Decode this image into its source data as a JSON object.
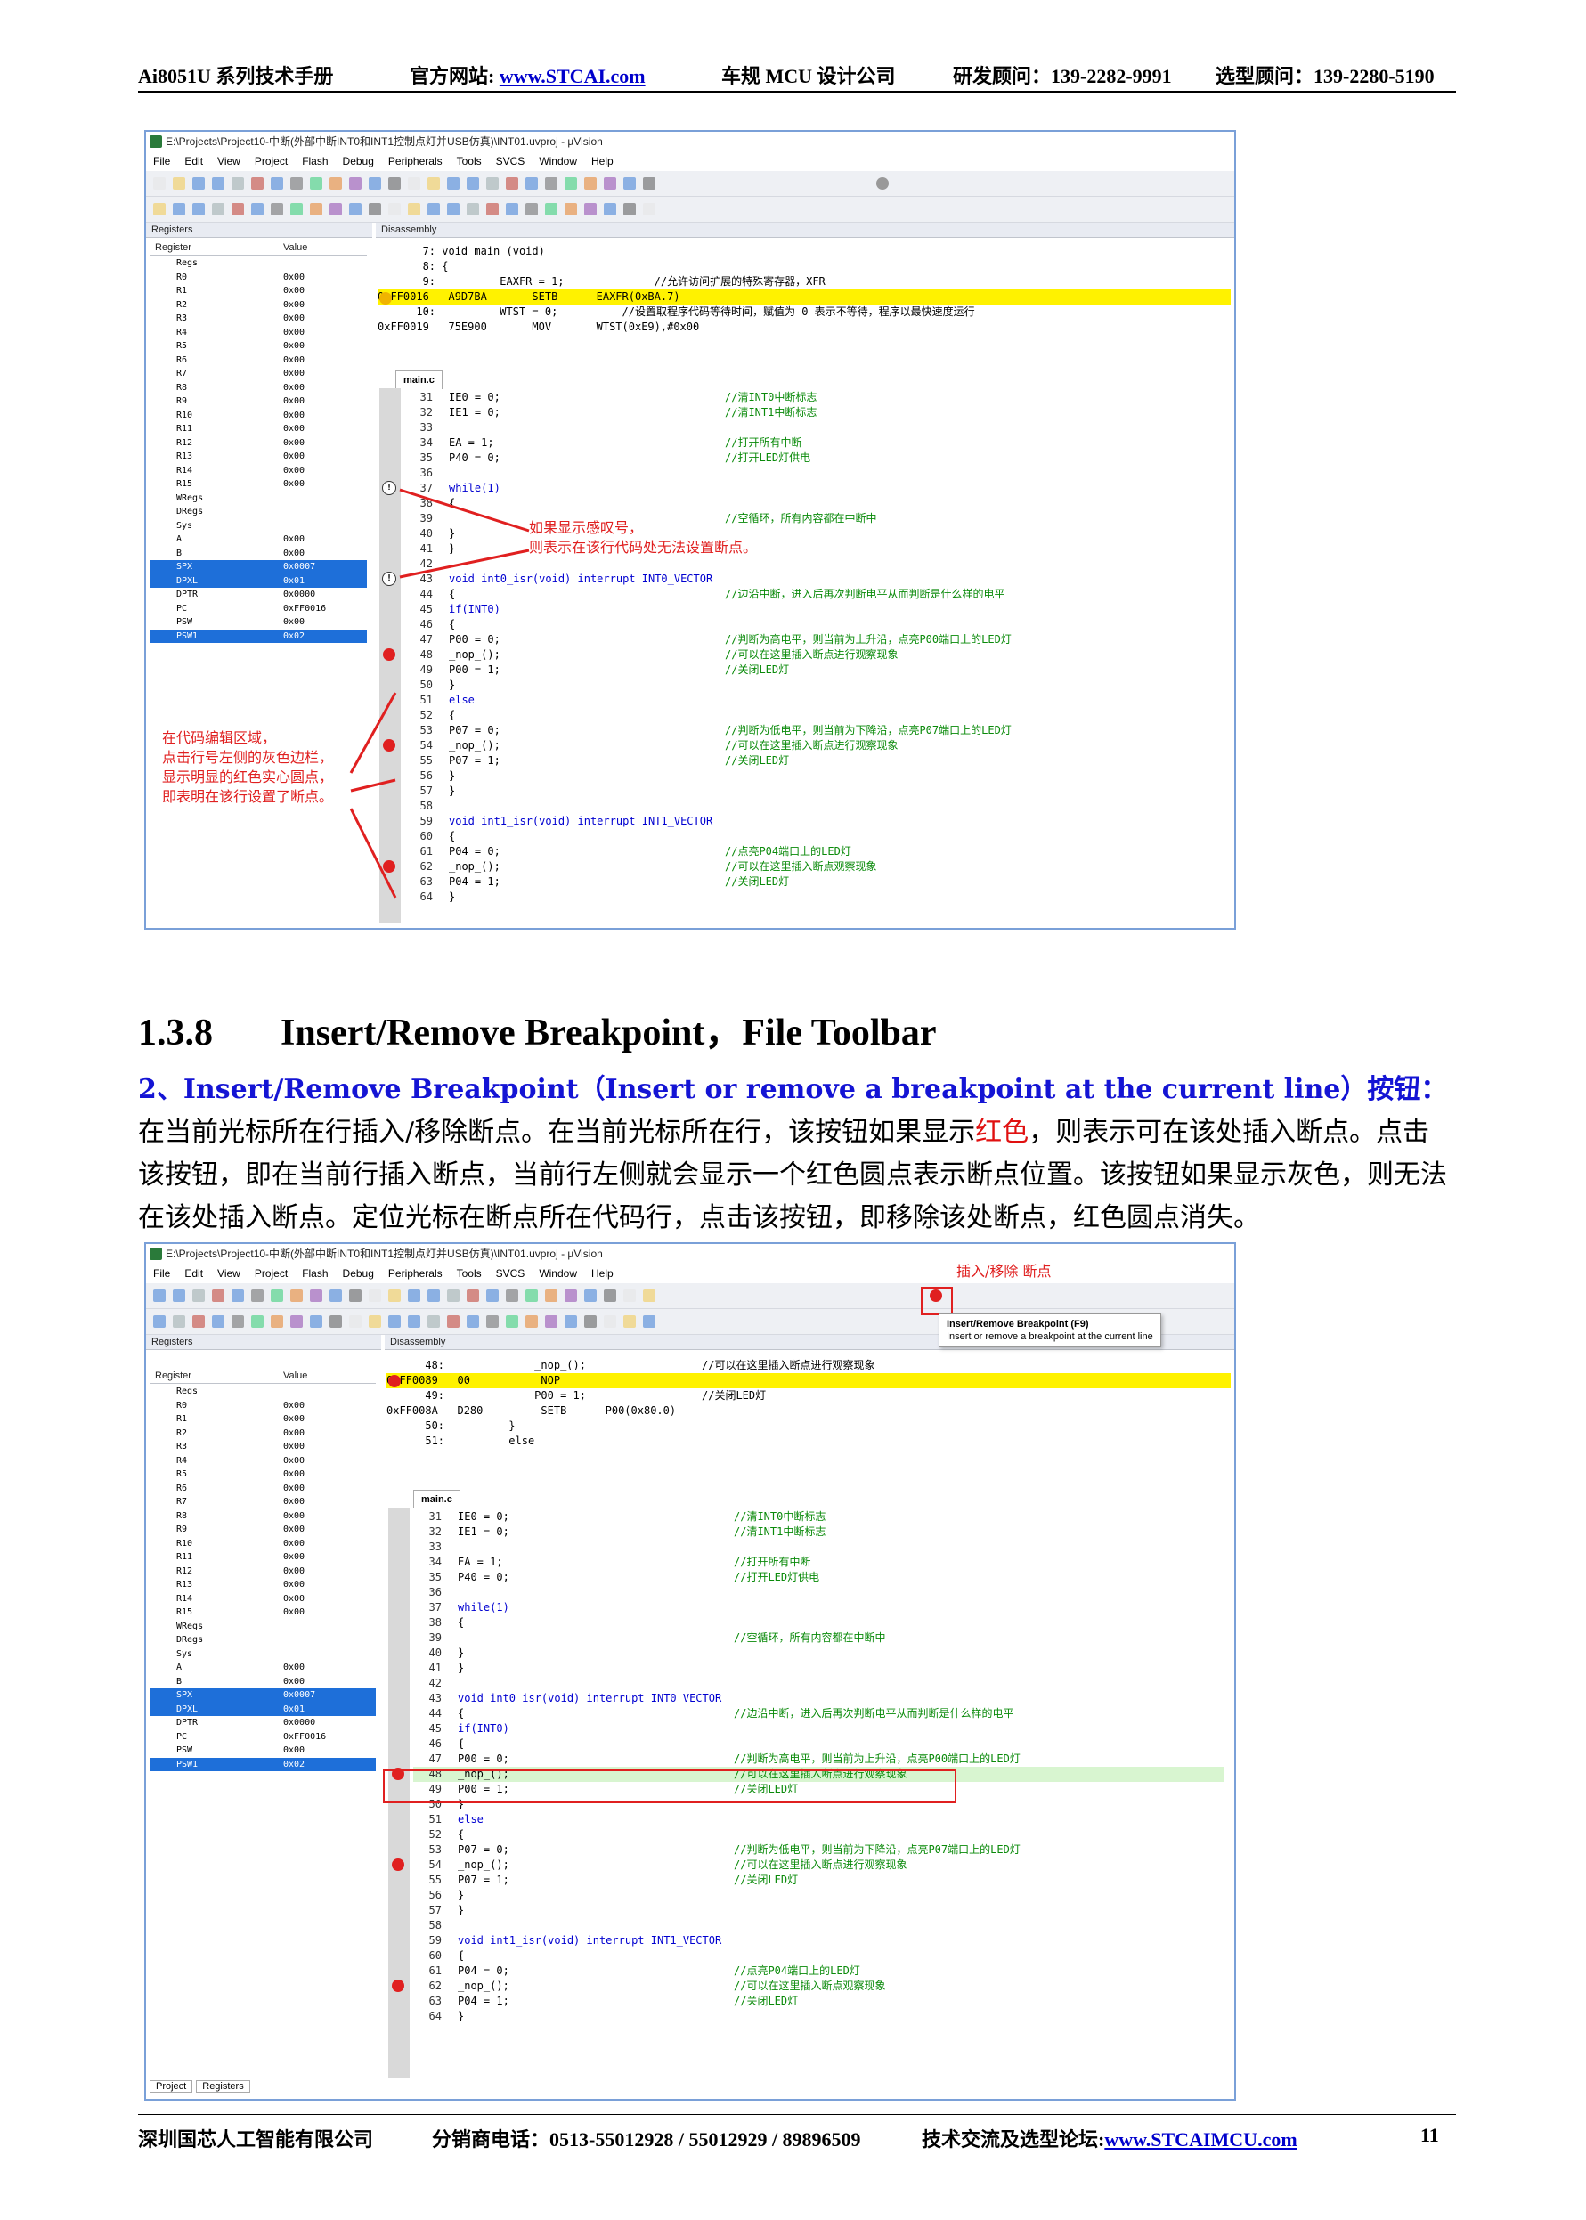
{
  "header": {
    "title": "Ai8051U 系列技术手册",
    "site_label": "官方网站:",
    "site": "www.STCAI.com",
    "company": "车规 MCU 设计公司",
    "dev_contact": "研发顾问：139-2282-9991",
    "sel_contact": "选型顾问：139-2280-5190"
  },
  "footer": {
    "company": "深圳国芯人工智能有限公司",
    "phone": "分销商电话：0513-55012928 / 55012929 / 89896509",
    "forum_label": "技术交流及选型论坛:",
    "forum": "www.STCAIMCU.com",
    "page": "11"
  },
  "section": {
    "number": "1.3.8",
    "title": "Insert/Remove Breakpoint，File Toolbar"
  },
  "paragraph": {
    "lead": "2、Insert/Remove Breakpoint（Insert or remove a breakpoint at the current line）按钮：",
    "p1": "在当前光标所在行插入/移除断点。在当前光标所在行，该按钮如果显示",
    "red_word": "红色",
    "p2": "，则表示可在该处插入断点。点击该按钮，即在当前行插入断点，当前行左侧就会显示一个红色圆点表示断点位置。该按钮如果显示灰色，则无法在该处插入断点。定位光标在断点所在代码行，点击该按钮，即移除该处断点，红色圆点消失。"
  },
  "window": {
    "title": "E:\\Projects\\Project10-中断(外部中断INT0和INT1控制点灯并USB仿真)\\INT01.uvproj - µVision",
    "menu": [
      "File",
      "Edit",
      "View",
      "Project",
      "Flash",
      "Debug",
      "Peripherals",
      "Tools",
      "SVCS",
      "Window",
      "Help"
    ],
    "registers_title": "Registers",
    "disassembly_title": "Disassembly",
    "col_register": "Register",
    "col_value": "Value",
    "tab_main": "main.c",
    "tab_project": "Project",
    "tab_registers": "Registers"
  },
  "registers": [
    {
      "n": "Regs",
      "v": ""
    },
    {
      "n": "R0",
      "v": "0x00"
    },
    {
      "n": "R1",
      "v": "0x00"
    },
    {
      "n": "R2",
      "v": "0x00"
    },
    {
      "n": "R3",
      "v": "0x00"
    },
    {
      "n": "R4",
      "v": "0x00"
    },
    {
      "n": "R5",
      "v": "0x00"
    },
    {
      "n": "R6",
      "v": "0x00"
    },
    {
      "n": "R7",
      "v": "0x00"
    },
    {
      "n": "R8",
      "v": "0x00"
    },
    {
      "n": "R9",
      "v": "0x00"
    },
    {
      "n": "R10",
      "v": "0x00"
    },
    {
      "n": "R11",
      "v": "0x00"
    },
    {
      "n": "R12",
      "v": "0x00"
    },
    {
      "n": "R13",
      "v": "0x00"
    },
    {
      "n": "R14",
      "v": "0x00"
    },
    {
      "n": "R15",
      "v": "0x00"
    },
    {
      "n": "WRegs",
      "v": ""
    },
    {
      "n": "DRegs",
      "v": ""
    },
    {
      "n": "Sys",
      "v": ""
    },
    {
      "n": "A",
      "v": "0x00"
    },
    {
      "n": "B",
      "v": "0x00"
    },
    {
      "n": "SPX",
      "v": "0x0007",
      "sel": true
    },
    {
      "n": "DPXL",
      "v": "0x01",
      "sel": true
    },
    {
      "n": "DPTR",
      "v": "0x0000"
    },
    {
      "n": "PC",
      "v": "0xFF0016"
    },
    {
      "n": "PSW",
      "v": "0x00"
    },
    {
      "n": "PSW1",
      "v": "0x02",
      "sel": true
    }
  ],
  "shot1": {
    "disasm": [
      {
        "t": "       7: void main (void)",
        "c": ""
      },
      {
        "t": "       8: {",
        "c": ""
      },
      {
        "t": "       9:          EAXFR = 1;              //允许访问扩展的特殊寄存器，XFR",
        "c": ""
      },
      {
        "t": "0xFF0016   A9D7BA       SETB      EAXFR(0xBA.7)",
        "c": "yl"
      },
      {
        "t": "      10:          WTST = 0;          //设置取程序代码等待时间，赋值为 0 表示不等待，程序以最快速度运行",
        "c": ""
      },
      {
        "t": "0xFF0019   75E900       MOV       WTST(0xE9),#0x00",
        "c": ""
      }
    ],
    "anno_warn": "如果显示感叹号，\n则表示在该行代码处无法设置断点。",
    "anno_bp": "在代码编辑区域，\n点击行号左侧的灰色边栏，\n显示明显的红色实心圆点，\n即表明在该行设置了断点。"
  },
  "shot2": {
    "disasm": [
      {
        "t": "      48:              _nop_();                  //可以在这里插入断点进行观察现象",
        "c": ""
      },
      {
        "t": "0xFF0089   00           NOP",
        "c": "yl"
      },
      {
        "t": "      49:              P00 = 1;                  //关闭LED灯",
        "c": ""
      },
      {
        "t": "0xFF008A   D280         SETB      P00(0x80.0)",
        "c": ""
      },
      {
        "t": "      50:          }",
        "c": ""
      },
      {
        "t": "      51:          else",
        "c": ""
      }
    ],
    "anno_button": "插入/移除 断点",
    "tip_title": "Insert/Remove Breakpoint (F9)",
    "tip_desc": "Insert or remove a breakpoint at the current line"
  },
  "code": [
    {
      "ln": "31",
      "t": "IE0 = 0;",
      "c": "//清INT0中断标志"
    },
    {
      "ln": "32",
      "t": "IE1 = 0;",
      "c": "//清INT1中断标志"
    },
    {
      "ln": "33",
      "t": "",
      "c": ""
    },
    {
      "ln": "34",
      "t": "EA = 1;",
      "c": "//打开所有中断"
    },
    {
      "ln": "35",
      "t": "P40 = 0;",
      "c": "//打开LED灯供电"
    },
    {
      "ln": "36",
      "t": "",
      "c": ""
    },
    {
      "ln": "37",
      "t": "while(1)",
      "c": ""
    },
    {
      "ln": "38",
      "t": "{",
      "c": ""
    },
    {
      "ln": "39",
      "t": "",
      "c": "//空循环，所有内容都在中断中"
    },
    {
      "ln": "40",
      "t": "}",
      "c": ""
    },
    {
      "ln": "41",
      "t": "}",
      "c": ""
    },
    {
      "ln": "42",
      "t": "",
      "c": ""
    },
    {
      "ln": "43",
      "t": "void int0_isr(void) interrupt INT0_VECTOR",
      "c": ""
    },
    {
      "ln": "44",
      "t": "{",
      "c": "//边沿中断，进入后再次判断电平从而判断是什么样的电平"
    },
    {
      "ln": "45",
      "t": "if(INT0)",
      "c": ""
    },
    {
      "ln": "46",
      "t": "{",
      "c": ""
    },
    {
      "ln": "47",
      "t": "P00 = 0;",
      "c": "//判断为高电平，则当前为上升沿，点亮P00端口上的LED灯"
    },
    {
      "ln": "48",
      "t": "_nop_();",
      "c": "//可以在这里插入断点进行观察现象"
    },
    {
      "ln": "49",
      "t": "P00 = 1;",
      "c": "//关闭LED灯"
    },
    {
      "ln": "50",
      "t": "}",
      "c": ""
    },
    {
      "ln": "51",
      "t": "else",
      "c": ""
    },
    {
      "ln": "52",
      "t": "{",
      "c": ""
    },
    {
      "ln": "53",
      "t": "P07 = 0;",
      "c": "//判断为低电平，则当前为下降沿，点亮P07端口上的LED灯"
    },
    {
      "ln": "54",
      "t": "_nop_();",
      "c": "//可以在这里插入断点进行观察现象"
    },
    {
      "ln": "55",
      "t": "P07 = 1;",
      "c": "//关闭LED灯"
    },
    {
      "ln": "56",
      "t": "}",
      "c": ""
    },
    {
      "ln": "57",
      "t": "}",
      "c": ""
    },
    {
      "ln": "58",
      "t": "",
      "c": ""
    },
    {
      "ln": "59",
      "t": "void int1_isr(void) interrupt INT1_VECTOR",
      "c": ""
    },
    {
      "ln": "60",
      "t": "{",
      "c": ""
    },
    {
      "ln": "61",
      "t": "P04 = 0;",
      "c": "//点亮P04端口上的LED灯"
    },
    {
      "ln": "62",
      "t": "_nop_();",
      "c": "//可以在这里插入断点观察现象"
    },
    {
      "ln": "63",
      "t": "P04 = 1;",
      "c": "//关闭LED灯"
    },
    {
      "ln": "64",
      "t": "}",
      "c": ""
    }
  ],
  "colors": {
    "breakpoint": "#e02020",
    "current_line": "#fff200",
    "selection": "#1e6fd9",
    "link": "#0000cc"
  }
}
